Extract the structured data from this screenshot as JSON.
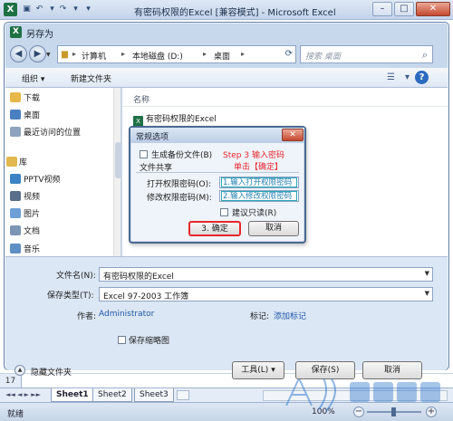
{
  "excel": {
    "logo": "X",
    "title": "有密码权限的Excel [兼容模式] - Microsoft Excel",
    "window_buttons": {
      "minimize": "–",
      "maximize": "□",
      "close": "✕"
    },
    "row_number": "17",
    "sheet_nav": "◄◄ ◄ ► ►►",
    "sheets": [
      "Sheet1",
      "Sheet2",
      "Sheet3"
    ],
    "status": "就绪",
    "zoom": "100%",
    "zoom_minus": "−",
    "zoom_plus": "+"
  },
  "save_dialog": {
    "icon": "X",
    "title": "另存为",
    "address": [
      "计算机",
      "本地磁盘 (D:)",
      "桌面"
    ],
    "search_placeholder": "搜索 桌面",
    "toolbar": {
      "organize": "组织 ▾",
      "new_folder": "新建文件夹"
    },
    "nav_items": [
      {
        "label": "下载",
        "icon": "download-folder-icon",
        "color": "#e8b84a"
      },
      {
        "label": "桌面",
        "icon": "desktop-icon",
        "color": "#4a7fc1"
      },
      {
        "label": "最近访问的位置",
        "icon": "recent-places-icon",
        "color": "#8fa3bd"
      },
      {
        "label": "库",
        "icon": "library-icon",
        "color": "#e2b94f"
      },
      {
        "label": "PPTV视频",
        "icon": "pptv-icon",
        "color": "#3b82c4"
      },
      {
        "label": "视频",
        "icon": "video-icon",
        "color": "#5b6e8a"
      },
      {
        "label": "图片",
        "icon": "pictures-icon",
        "color": "#6ca0d6"
      },
      {
        "label": "文档",
        "icon": "documents-icon",
        "color": "#7d95b5"
      },
      {
        "label": "音乐",
        "icon": "music-icon",
        "color": "#5d8fc4"
      }
    ],
    "column_name": "名称",
    "file": "有密码权限的Excel",
    "filename_label": "文件名(N):",
    "filename_value": "有密码权限的Excel",
    "filetype_label": "保存类型(T):",
    "filetype_value": "Excel 97-2003 工作簿",
    "author_label": "作者:",
    "author_value": "Administrator",
    "tags_label": "标记:",
    "tags_value": "添加标记",
    "thumbnail_label": "保存缩略图",
    "hide_folders": "隐藏文件夹",
    "tools_button": "工具(L)",
    "save_button": "保存(S)",
    "cancel_button": "取消"
  },
  "options_dialog": {
    "title": "常规选项",
    "close": "✕",
    "backup_label": "生成备份文件(B)",
    "step_note_1": "Step 3 输入密码",
    "step_note_2": "单击【确定】",
    "sharing_label": "文件共享",
    "open_pw_label": "打开权限密码(O):",
    "open_pw_note": "1.输入打开权限密码",
    "modify_pw_label": "修改权限密码(M):",
    "modify_pw_note": "2.输入修改权限密码",
    "readonly_label": "建议只读(R)",
    "ok_button": "3. 确定",
    "cancel_button": "取消"
  },
  "colors": {
    "annotation_red": "#e8262c",
    "annotation_teal": "#2aa7b8",
    "excel_green": "#1e7145"
  }
}
